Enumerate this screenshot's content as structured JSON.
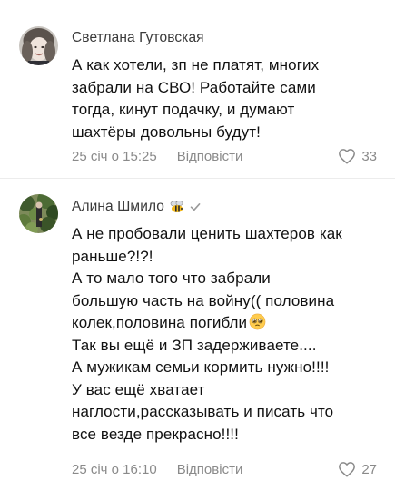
{
  "comments": [
    {
      "author": "Светлана Гутовская",
      "text_lines": [
        "А как хотели, зп не платят, многих",
        "забрали на СВО! Работайте сами",
        "тогда, кинут подачку, и думают",
        "шахтёры довольны будут!"
      ],
      "time": "25 січ о 15:25",
      "reply_label": "Відповісти",
      "likes": "33"
    },
    {
      "author": "Алина Шмило",
      "badges": [
        "bee-icon",
        "check-icon"
      ],
      "text_lines": [
        "А не пробовали ценить шахтеров как",
        "раньше?!?!",
        "А то мало того что забрали",
        "большую часть на войну(( половина",
        "колек,половина погибли",
        "Так вы ещё и ЗП задерживаете....",
        "А мужикам семьи кормить нужно!!!!",
        "У вас ещё хватает",
        "наглости,рассказывать и писать что",
        "все везде прекрасно!!!!"
      ],
      "emoji_after_line": "pleading-face-icon",
      "time": "25 січ о 16:10",
      "reply_label": "Відповісти",
      "likes": "27"
    }
  ],
  "colors": {
    "text": "#111111",
    "author": "#3a3a3a",
    "meta": "#8a8a8a",
    "divider": "#ececec"
  }
}
